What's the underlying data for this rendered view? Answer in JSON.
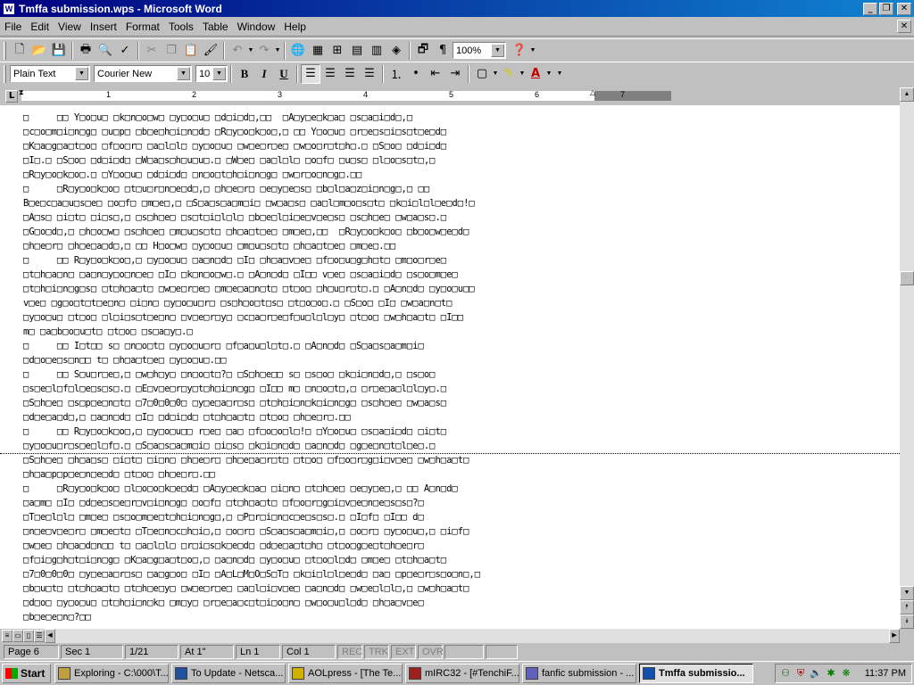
{
  "window": {
    "title": "Tmffa submission.wps - Microsoft Word",
    "minimize": "_",
    "restore": "❐",
    "close": "✕"
  },
  "menu": [
    "File",
    "Edit",
    "View",
    "Insert",
    "Format",
    "Tools",
    "Table",
    "Window",
    "Help"
  ],
  "toolbar": {
    "zoom": "100%",
    "style": "Plain Text",
    "font": "Courier New",
    "font_size": "10",
    "bold": "B",
    "italic": "I",
    "underline": "U"
  },
  "ruler": {
    "tab_selector": "L",
    "numbers": [
      "1",
      "2",
      "3",
      "4",
      "5",
      "6",
      "7"
    ]
  },
  "document": {
    "lines": [
      "□     □□ Y□o□u□ □k□n□o□w□ □y□o□u□ □d□i□d□,□□  □A□y□e□k□a□ □s□a□i□d□,□",
      "□c□o□m□i□n□g□ □u□p□ □b□e□h□i□n□d□ □R□y□o□k□o□,□ □□ Y□o□u□ □r□e□s□i□s□t□e□d□",
      "□K□a□g□a□t□o□ □f□o□r□ □a□l□l□ □y□o□u□ □w□e□r□e□ □w□o□r□t□h□.□ □S□o□ □d□i□d□",
      "□I□.□ □S□o□ □d□i□d□ □W□a□s□h□u□u□.□ □W□e□ □a□l□l□ □o□f□ □u□s□ □l□o□s□t□,□",
      "□R□y□o□k□o□.□ □Y□o□u□ □d□i□d□ □n□o□t□h□i□n□g□ □w□r□o□n□g□.□□",
      "□     □R□y□o□k□o□ □t□u□r□n□e□d□,□ □h□e□r□ □e□y□e□s□ □b□l□a□z□i□n□g□,□ □□",
      "B□e□c□a□u□s□e□ □o□f□ □m□e□,□ □S□a□s□a□m□i□ □w□a□s□ □a□l□m□o□s□t□ □k□i□l□l□e□d□!□",
      "□A□s□ □i□t□ □i□s□,□ □s□h□e□ □s□t□i□l□l□ □b□e□l□i□e□v□e□s□ □s□h□e□ □w□a□s□.□",
      "□G□o□d□,□ □h□o□w□ □s□h□e□ □m□u□s□t□ □h□a□t□e□ □m□e□,□□  □R□y□o□k□o□ □b□o□w□e□d□",
      "□h□e□r□ □h□e□a□d□,□ □□ H□o□w□ □y□o□u□ □m□u□s□t□ □h□a□t□e□ □m□e□.□□",
      "□     □□ R□y□o□k□o□,□ □y□o□u□ □a□n□d□ □I□ □h□a□v□e□ □f□o□u□g□h□t□ □m□o□r□e□",
      "□t□h□a□n□ □a□n□y□o□n□e□ □I□ □k□n□o□w□.□ □A□n□d□ □I□□ v□e□ □s□a□i□d□ □s□o□m□e□",
      "□t□h□i□n□g□s□ □t□h□a□t□ □w□e□r□e□ □m□e□a□n□t□ □t□o□ □h□u□r□t□.□ □A□n□d□ □y□o□u□□",
      "v□e□ □g□o□t□t□e□n□ □i□n□ □y□o□u□r□ □s□h□o□t□s□ □t□o□o□.□ □S□o□ □I□ □w□a□n□t□",
      "□y□o□u□ □t□o□ □l□i□s□t□e□n□ □v□e□r□y□ □c□a□r□e□f□u□l□l□y□ □t□o□ □w□h□a□t□ □I□□",
      "m□ □a□b□o□u□t□ □t□o□ □s□a□y□.□",
      "□     □□ I□t□□ s□ □n□o□t□ □y□o□u□r□ □f□a□u□l□t□.□ □A□n□d□ □S□a□s□a□m□i□",
      "□d□o□e□s□n□□ t□ □h□a□t□e□ □y□o□u□.□□",
      "□     □□ S□u□r□e□,□ □w□h□y□ □n□o□t□?□ □S□h□e□□ s□ □s□o□ □k□i□n□d□,□ □s□o□",
      "□s□e□l□f□l□e□s□s□.□ □E□v□e□r□y□t□h□i□n□g□ □I□□ m□ □n□o□t□,□ □r□e□a□l□l□y□.□",
      "□S□h□e□ □s□p□e□n□t□ □7□0□0□0□ □y□e□a□r□s□ □t□h□i□n□k□i□n□g□ □s□h□e□ □w□a□s□",
      "□d□e□a□d□,□ □a□n□d□ □I□ □d□i□d□ □t□h□a□t□ □t□o□ □h□e□r□.□□",
      "□     □□ R□y□o□k□o□,□ □y□o□u□□ r□e□ □a□ □f□o□o□l□!□ □Y□o□u□ □s□a□i□d□ □i□t□",
      "□y□o□u□r□s□e□l□f□.□ □S□a□s□a□m□i□ □i□s□ □k□i□n□d□ □a□n□d□ □g□e□n□t□l□e□.□",
      "□S□h□e□ □h□a□s□ □i□t□ □i□n□ □h□e□r□ □h□e□a□r□t□ □t□o□ □f□o□r□g□i□v□e□ □w□h□a□t□",
      "□h□a□p□p□e□n□e□d□ □t□o□ □h□e□r□.□□",
      "□     □R□y□o□k□o□ □l□o□o□k□e□d□ □A□y□e□k□a□ □i□n□ □t□h□e□ □e□y□e□,□ □□ A□n□d□",
      "□a□m□ □I□ □d□e□s□e□r□v□i□n□g□ □o□f□ □t□h□a□t□ □f□o□r□g□i□v□e□n□e□s□s□?□",
      "□T□e□l□l□ □m□e□ □s□o□m□e□t□h□i□n□g□,□ □P□r□i□n□c□e□s□s□.□ □I□f□ □I□□ d□",
      "□n□e□v□e□r□ □m□e□t□ □T□e□n□c□h□i□,□ □o□r□ □S□a□s□a□m□i□,□ □o□r□ □y□o□u□,□ □i□f□",
      "□w□e□ □h□a□d□n□□ t□ □a□l□l□ □r□i□s□k□e□d□ □d□e□a□t□h□ □t□o□g□e□t□h□e□r□",
      "□f□i□g□h□t□i□n□g□ □K□a□g□a□t□o□,□ □a□n□d□ □y□o□u□ □t□o□l□d□ □m□e□ □t□h□a□t□",
      "□7□0□0□0□ □y□e□a□r□s□ □a□g□o□ □I□ □A□L□M□O□S□T□ □k□i□l□l□e□d□ □a□ □p□e□r□s□o□n□,□",
      "□b□u□t□ □t□h□a□t□ □t□h□e□y□ □w□e□r□e□ □a□l□i□v□e□ □a□n□d□ □w□e□l□l□,□ □w□h□a□t□",
      "□d□o□ □y□o□u□ □t□h□i□n□k□ □m□y□ □r□e□a□c□t□i□o□n□ □w□o□u□l□d□ □h□a□v□e□",
      "□b□e□e□n□?□□"
    ]
  },
  "status": {
    "page": "Page 6",
    "sec": "Sec 1",
    "pages": "1/21",
    "at": "At 1\"",
    "ln": "Ln 1",
    "col": "Col 1",
    "rec": "REC",
    "trk": "TRK",
    "ext": "EXT",
    "ovr": "OVR"
  },
  "taskbar": {
    "start": "Start",
    "tasks": [
      {
        "label": "Exploring - C:\\000\\T...",
        "color": "#c0a040"
      },
      {
        "label": "To Update - Netsca...",
        "color": "#2050a0"
      },
      {
        "label": "AOLpress - [The Te...",
        "color": "#d0b000"
      },
      {
        "label": "mIRC32 - [#TenchiF...",
        "color": "#a02020"
      },
      {
        "label": "fanfic submission - ...",
        "color": "#6060c0"
      },
      {
        "label": "Tmffa submissio...",
        "color": "#1050b0"
      }
    ],
    "clock": "11:37 PM"
  }
}
